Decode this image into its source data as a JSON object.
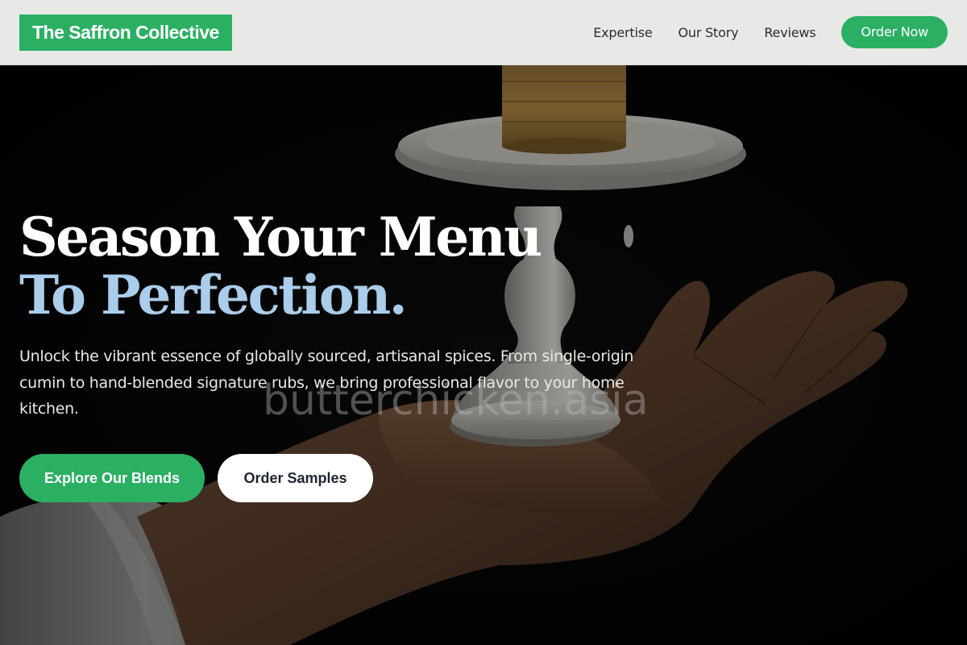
{
  "header": {
    "brand": "The Saffron Collective",
    "nav": [
      "Expertise",
      "Our Story",
      "Reviews"
    ],
    "cta": "Order Now"
  },
  "hero": {
    "headline_line1": "Season Your Menu",
    "headline_line2": "To Perfection.",
    "lead": "Unlock the vibrant essence of globally sourced, artisanal spices. From single-origin cumin to hand-blended signature rubs, we bring professional flavor to your home kitchen.",
    "primary_button": "Explore Our Blends",
    "secondary_button": "Order Samples",
    "watermark": "butterchicken.asia"
  },
  "colors": {
    "brand_green": "#2bb063",
    "headline_accent": "#a9cdea",
    "header_bg": "#e8e9e7"
  }
}
